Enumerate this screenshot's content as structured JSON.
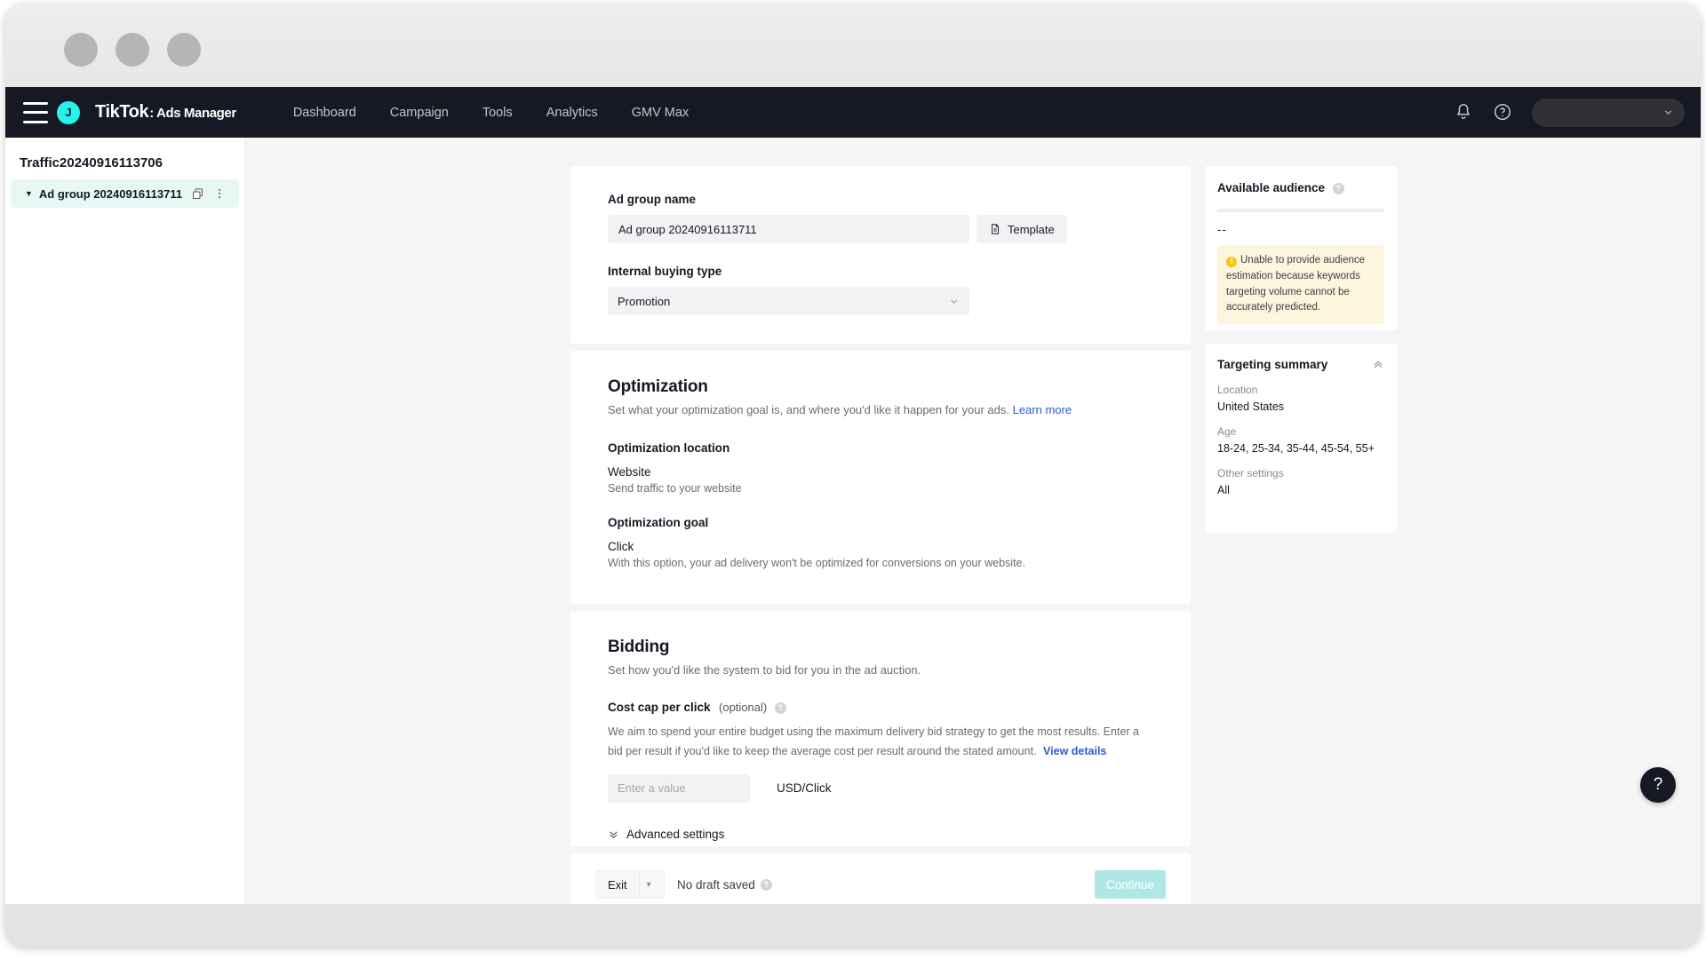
{
  "window": {
    "dots": [
      "minimize",
      "maximize",
      "close"
    ]
  },
  "topnav": {
    "brand": "TikTok",
    "brand_sub": ": Ads Manager",
    "avatar_initial": "J",
    "links": [
      {
        "label": "Dashboard"
      },
      {
        "label": "Campaign"
      },
      {
        "label": "Tools"
      },
      {
        "label": "Analytics"
      },
      {
        "label": "GMV Max"
      }
    ],
    "icons": [
      "bell-icon",
      "help-circle-icon"
    ],
    "account_pill": ""
  },
  "sidebar": {
    "campaign_title": "Traffic20240916113706",
    "adgroup": {
      "label": "Ad group 20240916113711",
      "caret": "▼",
      "actions": [
        "copy-icon",
        "more-options-icon"
      ]
    }
  },
  "basic": {
    "adgroup_name_label": "Ad group name",
    "adgroup_name_value": "Ad group 20240916113711",
    "template_button": "Template",
    "buying_type_label": "Internal buying type",
    "buying_type_value": "Promotion"
  },
  "optimization": {
    "title": "Optimization",
    "subtitle": "Set what your optimization goal is, and where you'd like it happen for your ads.",
    "learn_more": "Learn more",
    "location_label": "Optimization location",
    "location_value": "Website",
    "location_desc": "Send traffic to your website",
    "goal_label": "Optimization goal",
    "goal_value": "Click",
    "goal_desc": "With this option, your ad delivery won't be optimized for conversions on your website."
  },
  "bidding": {
    "title": "Bidding",
    "subtitle": "Set how you'd like the system to bid for you in the ad auction.",
    "cost_cap_label": "Cost cap per click",
    "cost_cap_optional": "(optional)",
    "cost_cap_desc": "We aim to spend your entire budget using the maximum delivery bid strategy to get the most results. Enter a bid per result if you'd like to keep the average cost per result around the stated amount.",
    "view_details": "View details",
    "bid_placeholder": "Enter a value",
    "bid_value": "",
    "bid_unit": "USD/Click",
    "advanced_settings": "Advanced settings"
  },
  "footer": {
    "exit_label": "Exit",
    "draft_status": "No draft saved",
    "continue_label": "Continue"
  },
  "rail": {
    "audience": {
      "title": "Available audience",
      "value": "--",
      "warning": "Unable to provide audience estimation because keywords targeting volume cannot be accurately predicted."
    },
    "targeting": {
      "title": "Targeting summary",
      "rows": [
        {
          "key": "Location",
          "value": "United States"
        },
        {
          "key": "Age",
          "value": "18-24, 25-34, 35-44, 45-54, 55+"
        },
        {
          "key": "Other settings",
          "value": "All"
        }
      ]
    }
  },
  "floating": {
    "help_label": "?"
  },
  "colors": {
    "nav_bg": "#161823",
    "brand_teal": "#25F4EE",
    "accent_link": "#2d5bd7",
    "continue_disabled": "#aee7e4",
    "sidebar_selected": "#e7f8f4",
    "warning_bg": "#fdf6dd",
    "warning_icon": "#f5c518",
    "page_bg": "#f5f5f5"
  }
}
